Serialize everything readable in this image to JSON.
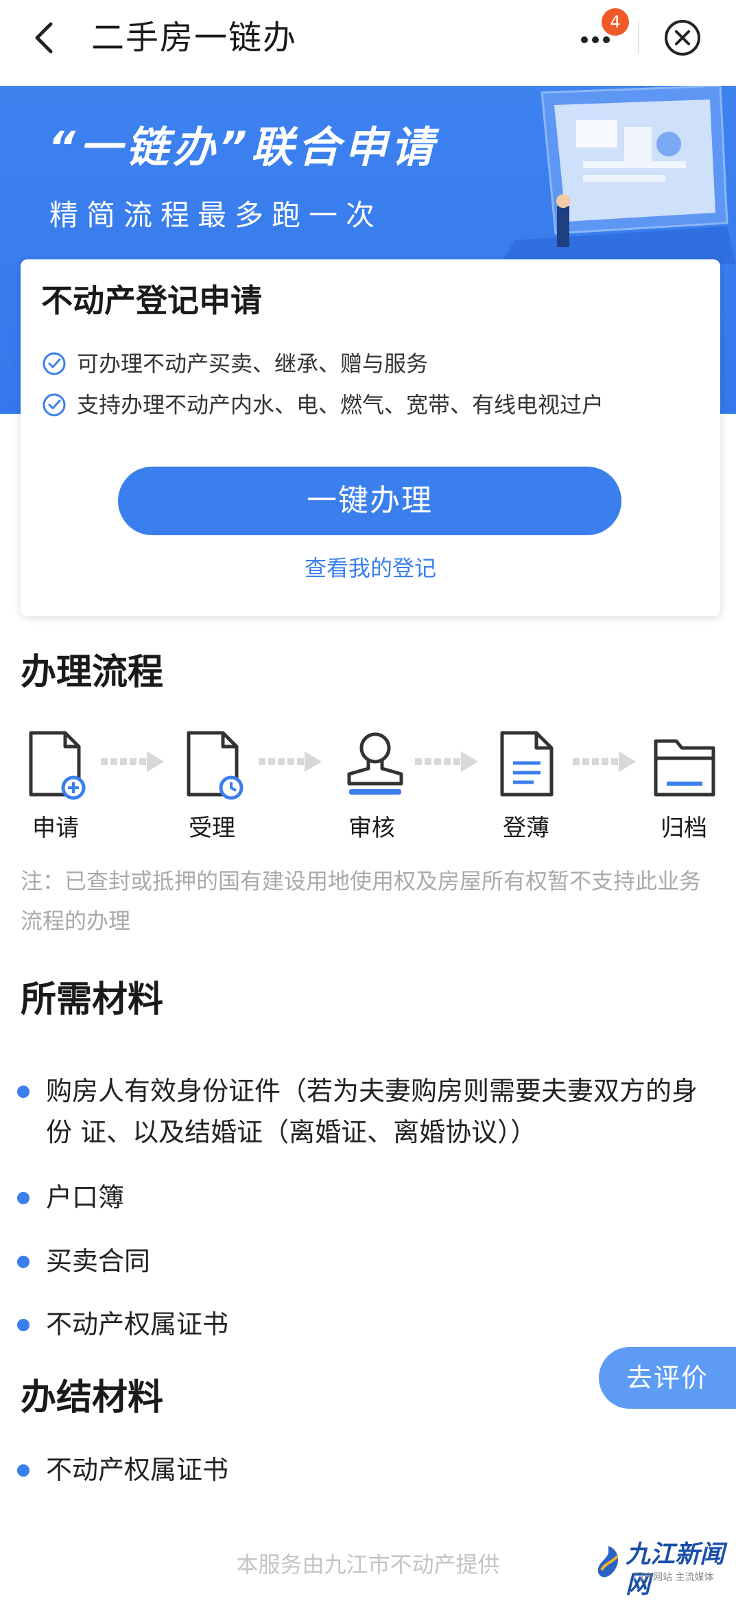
{
  "nav": {
    "title": "二手房一链办",
    "badge": "4"
  },
  "banner": {
    "title": "“一链办”联合申请",
    "subtitle": "精简流程最多跑一次"
  },
  "card": {
    "title": "不动产登记申请",
    "features": [
      "可办理不动产买卖、继承、赠与服务",
      "支持办理不动产内水、电、燃气、宽带、有线电视过户"
    ],
    "primary_button": "一键办理",
    "link": "查看我的登记"
  },
  "process": {
    "title": "办理流程",
    "steps": [
      {
        "label": "申请",
        "icon": "document-add-icon"
      },
      {
        "label": "受理",
        "icon": "document-clock-icon"
      },
      {
        "label": "审核",
        "icon": "stamp-icon"
      },
      {
        "label": "登薄",
        "icon": "document-lines-icon"
      },
      {
        "label": "归档",
        "icon": "folder-icon"
      }
    ],
    "note": "注：已查封或抵押的国有建设用地使用权及房屋所有权暂不支持此业务流程的办理"
  },
  "required_materials": {
    "title": "所需材料",
    "items": [
      "购房人有效身份证件（若为夫妻购房则需要夫妻双方的身份 证、以及结婚证（离婚证、离婚协议））",
      "户口簿",
      "买卖合同",
      "不动产权属证书"
    ]
  },
  "completion_materials": {
    "title": "办结材料",
    "items": [
      "不动产权属证书"
    ]
  },
  "eval_button": "去评价",
  "footer": "本服务由九江市不动产提供",
  "watermark": {
    "name": "九江新闻网",
    "sub": "门户网站 主流媒体"
  },
  "colors": {
    "primary": "#3a7fed",
    "banner": "#3e82f0",
    "badge": "#f05a28",
    "note": "#aaaaaa"
  }
}
